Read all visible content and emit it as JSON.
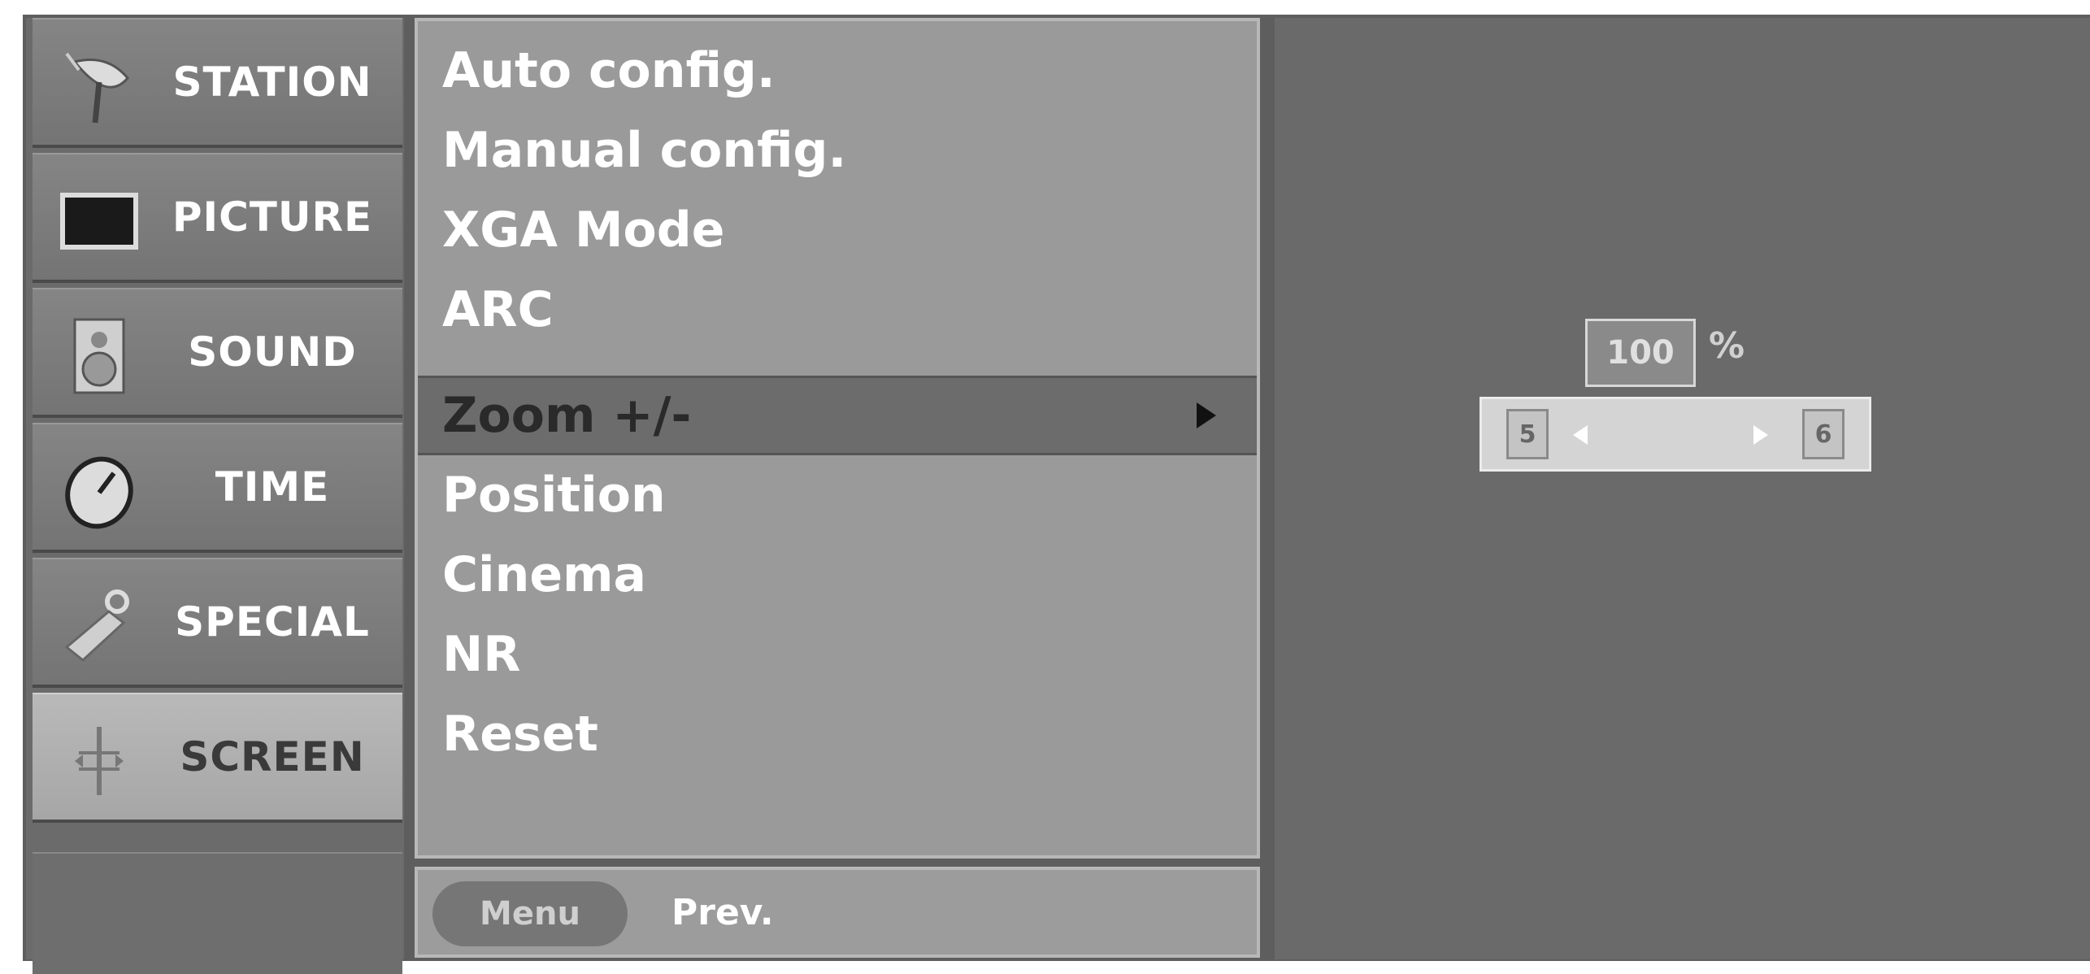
{
  "sidebar": {
    "items": [
      {
        "label": "STATION",
        "icon": "satellite-dish-icon"
      },
      {
        "label": "PICTURE",
        "icon": "monitor-icon"
      },
      {
        "label": "SOUND",
        "icon": "speaker-icon"
      },
      {
        "label": "TIME",
        "icon": "clock-icon"
      },
      {
        "label": "SPECIAL",
        "icon": "key-tag-icon"
      },
      {
        "label": "SCREEN",
        "icon": "screen-adjust-icon"
      }
    ],
    "active": "SCREEN"
  },
  "menu": {
    "items": [
      {
        "label": "Auto config."
      },
      {
        "label": "Manual config."
      },
      {
        "label": "XGA Mode"
      },
      {
        "label": "ARC"
      },
      {
        "label": "Zoom +/-"
      },
      {
        "label": "Position"
      },
      {
        "label": "Cinema"
      },
      {
        "label": "NR"
      },
      {
        "label": "Reset"
      }
    ],
    "selected": "Zoom +/-"
  },
  "footer": {
    "button_label": "Menu",
    "prev_label": "Prev."
  },
  "zoom": {
    "value": "100",
    "unit": "%",
    "left_key": "5",
    "right_key": "6"
  },
  "colors": {
    "sidebar_active": "#b0b0b0",
    "menu_background": "#9a9a9a",
    "selected_row": "#6c6c6c",
    "panel_background": "#6a6a6a"
  }
}
